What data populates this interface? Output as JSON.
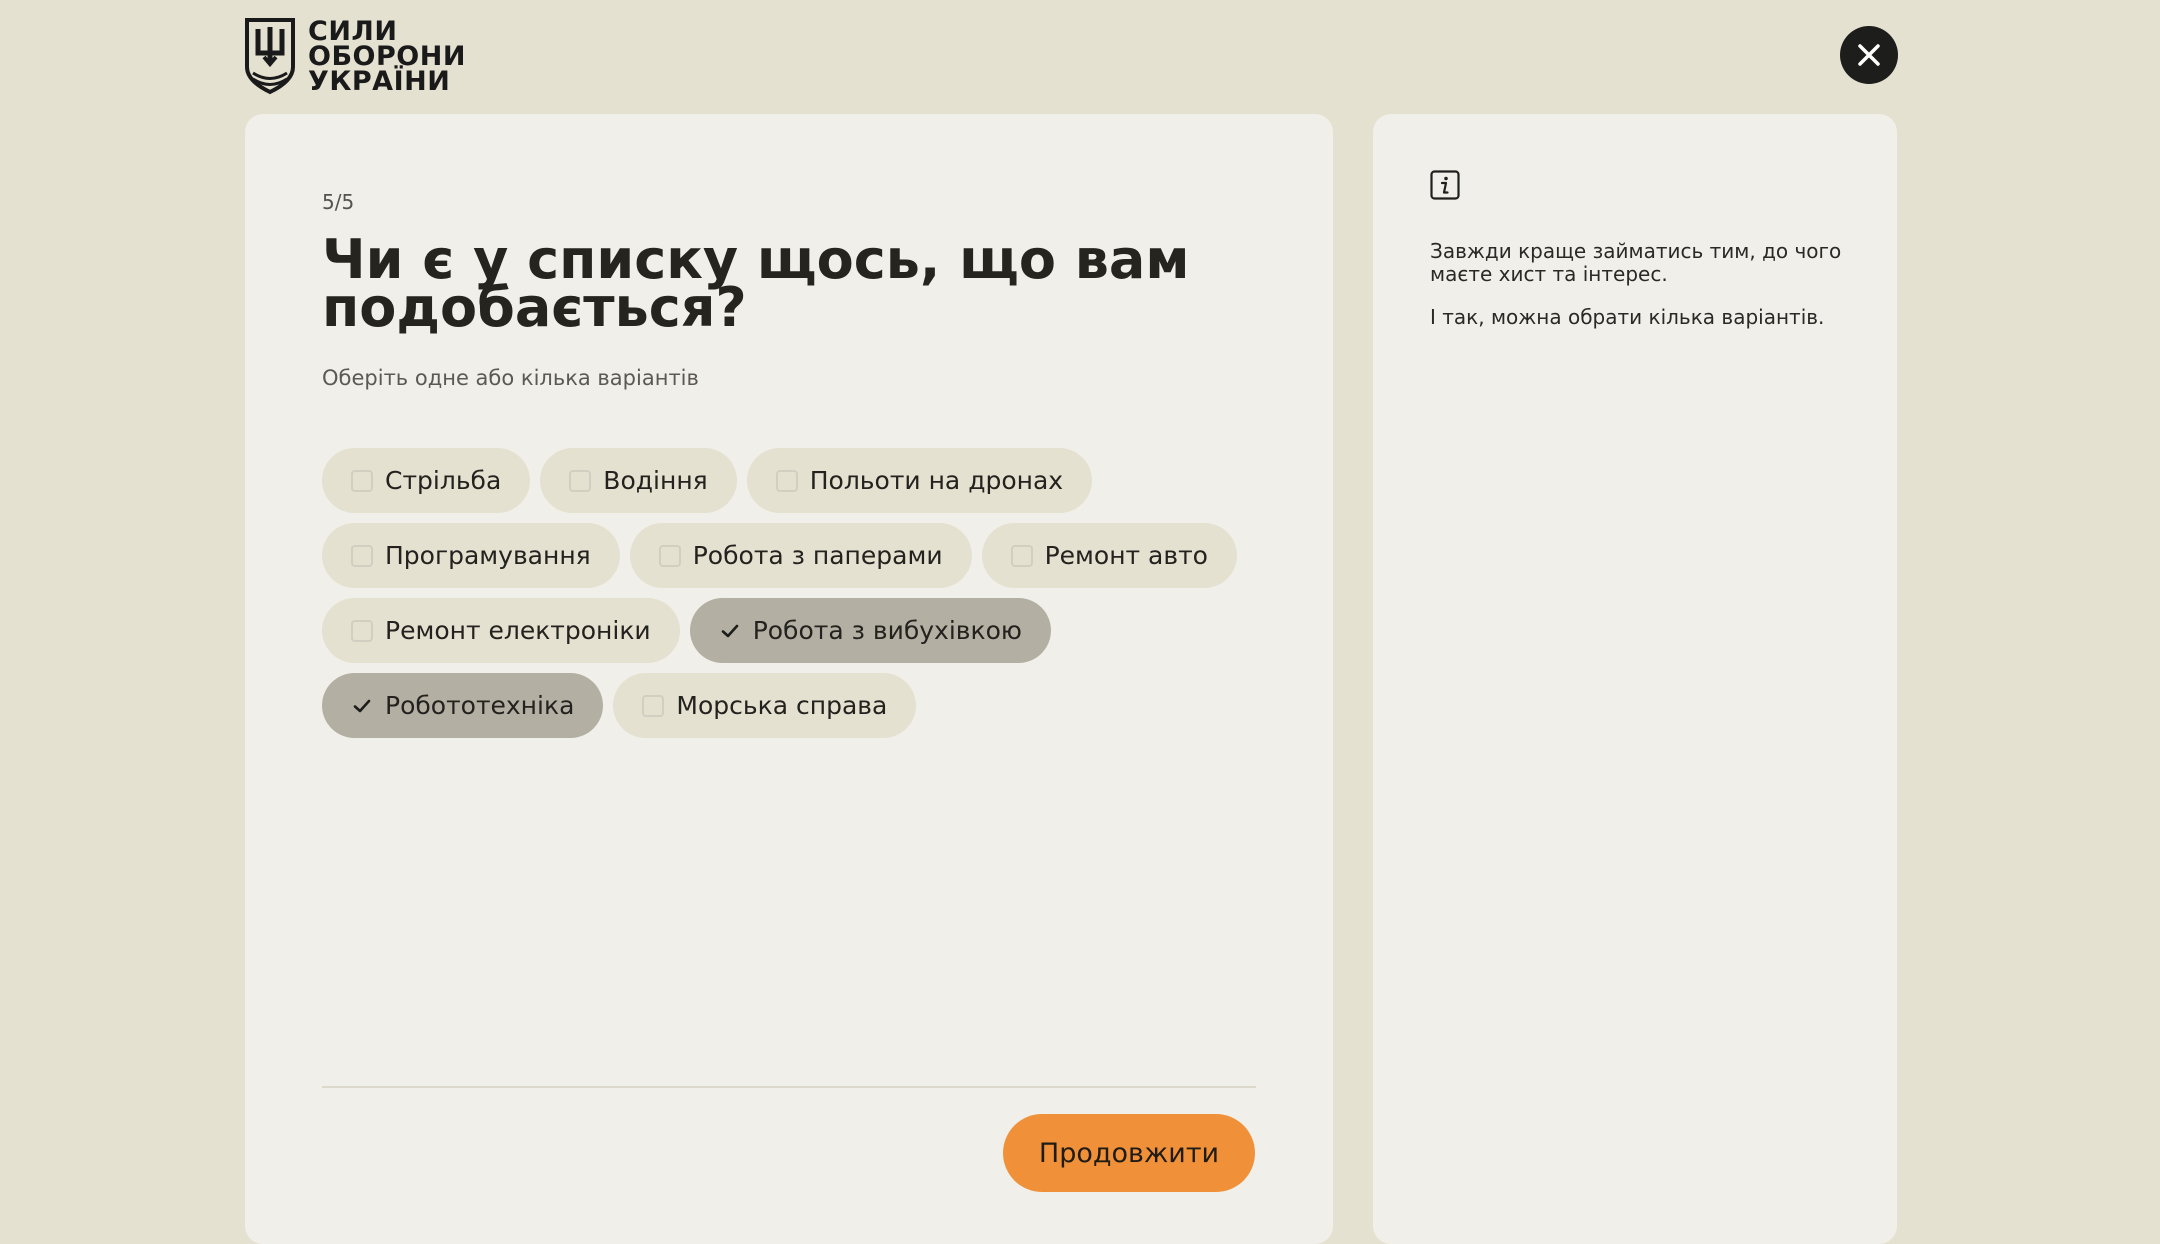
{
  "header": {
    "logo_lines": [
      "СИЛИ",
      "ОБОРОНИ",
      "УКРАЇНИ"
    ],
    "close_icon": "close-icon"
  },
  "quiz": {
    "step": "5/5",
    "question": "Чи є у списку щось, що вам подобається?",
    "hint": "Оберіть одне або кілька варіантів",
    "options": [
      {
        "label": "Стрільба",
        "selected": false
      },
      {
        "label": "Водіння",
        "selected": false
      },
      {
        "label": "Польоти на дронах",
        "selected": false
      },
      {
        "label": "Програмування",
        "selected": false
      },
      {
        "label": "Робота з паперами",
        "selected": false
      },
      {
        "label": "Ремонт авто",
        "selected": false
      },
      {
        "label": "Ремонт електроніки",
        "selected": false
      },
      {
        "label": "Робота з вибухівкою",
        "selected": true
      },
      {
        "label": "Робототехніка",
        "selected": true
      },
      {
        "label": "Морська справа",
        "selected": false
      }
    ],
    "continue_label": "Продовжити"
  },
  "info": {
    "icon": "info-icon",
    "paragraphs": [
      "Завжди краще займатись тим, до чого маєте хист та інтерес.",
      "І так, можна обрати кілька варіантів."
    ]
  },
  "colors": {
    "page_bg": "#e4e1d0",
    "card_bg": "#f1efe9",
    "chip_bg": "#e4e1d0",
    "chip_selected_bg": "#b3b0a3",
    "accent": "#f0913a",
    "dark": "#1d1d1b"
  }
}
